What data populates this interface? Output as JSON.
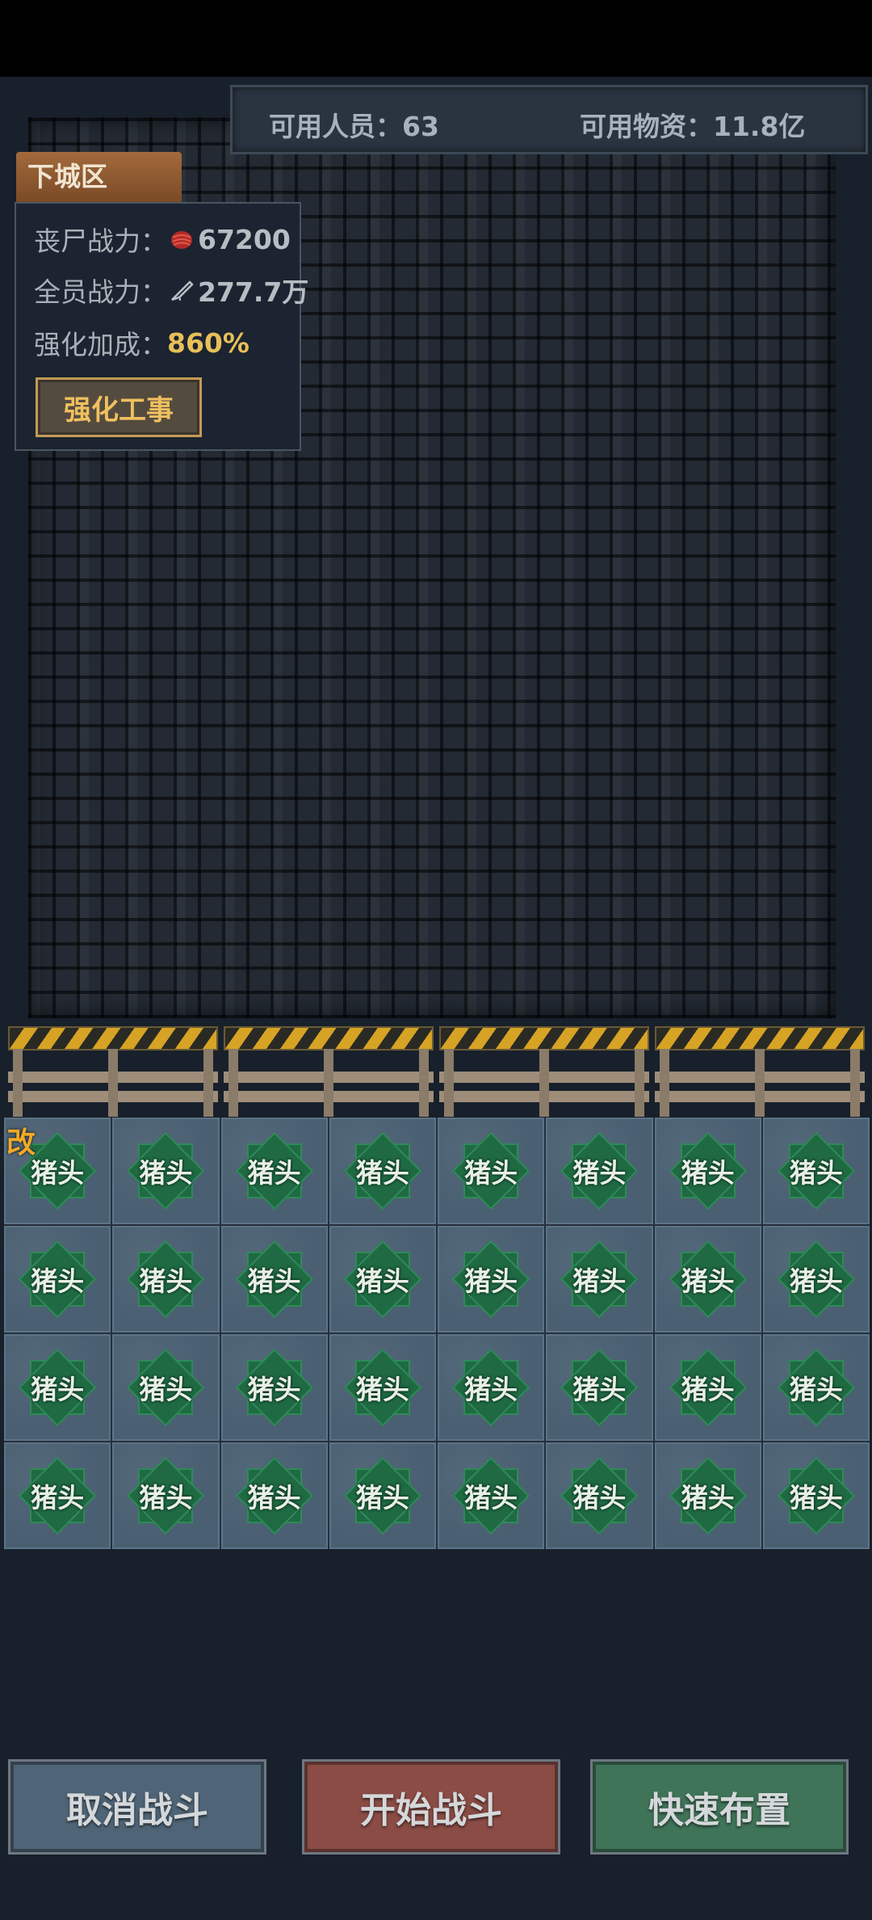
{
  "resources": {
    "people": "可用人员：63",
    "supply": "可用物资：11.8亿"
  },
  "zone": {
    "name": "下城区"
  },
  "stats": {
    "zombie_label": "丧尸战力：",
    "zombie_value": "67200",
    "team_label": "全员战力：",
    "team_value": "277.7万",
    "bonus_label": "强化加成：",
    "bonus_value": "860%",
    "enhance_button": "强化工事"
  },
  "grid": {
    "mod_mark": "改",
    "unit_label": "猪头",
    "rows": 4,
    "cols": 8
  },
  "actions": {
    "cancel": "取消战斗",
    "start": "开始战斗",
    "quick": "快速布置"
  },
  "icons": {
    "zombie": "zombie-power-icon",
    "team": "weapon-power-icon",
    "unit": "green-star-unit-icon"
  }
}
